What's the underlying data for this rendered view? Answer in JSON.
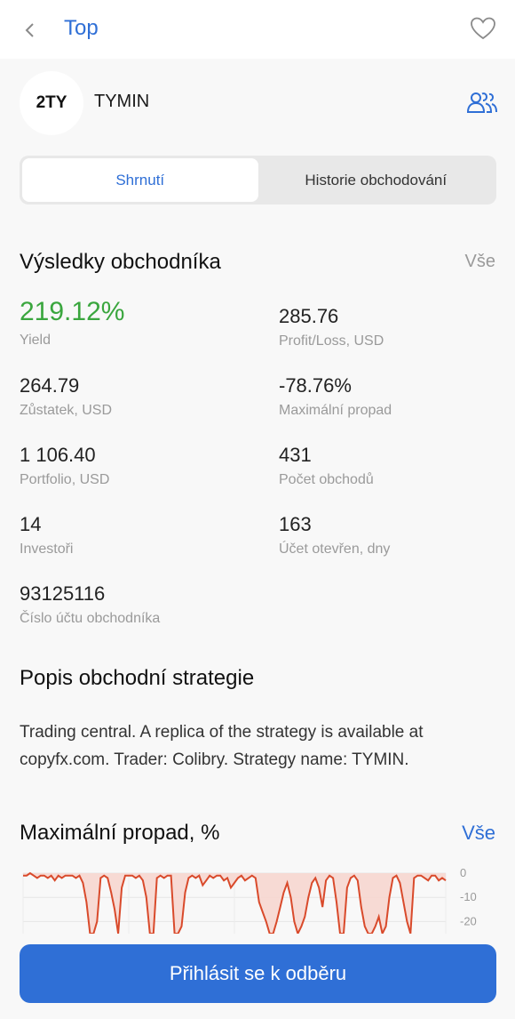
{
  "header": {
    "back_icon": "chevron-left-icon",
    "title": "Top",
    "favorite_icon": "heart-outline-icon"
  },
  "trader": {
    "avatar_text": "2TY",
    "name": "TYMIN",
    "investors_icon": "people-icon"
  },
  "tabs": [
    {
      "label": "Shrnutí",
      "active": true
    },
    {
      "label": "Historie obchodování",
      "active": false
    }
  ],
  "results": {
    "title": "Výsledky obchodníka",
    "all_link": "Vše",
    "stats": [
      {
        "value": "219.12%",
        "label": "Yield"
      },
      {
        "value": "285.76",
        "label": "Profit/Loss, USD"
      },
      {
        "value": "264.79",
        "label": "Zůstatek, USD"
      },
      {
        "value": "-78.76%",
        "label": "Maximální propad"
      },
      {
        "value": "1 106.40",
        "label": "Portfolio, USD"
      },
      {
        "value": "431",
        "label": "Počet obchodů"
      },
      {
        "value": "14",
        "label": "Investoři"
      },
      {
        "value": "163",
        "label": "Účet otevřen, dny"
      },
      {
        "value": "93125116",
        "label": "Číslo účtu obchodníka"
      }
    ]
  },
  "strategy": {
    "title": "Popis obchodní strategie",
    "text": "Trading central. A replica of the strategy is available at copyfx.com. Trader: Colibry. Strategy name: TYMIN."
  },
  "drawdown": {
    "title": "Maximální propad, %",
    "all_link": "Vše"
  },
  "chart_data": {
    "type": "area",
    "title": "Maximální propad, %",
    "ytick_labels": [
      "0",
      "-10",
      "-20"
    ],
    "ylim": [
      -25,
      0
    ],
    "values": [
      -1,
      -1,
      0,
      -1,
      -2,
      -1,
      -1,
      -2,
      -1,
      -3,
      -1,
      -2,
      -1,
      -1,
      -1,
      -2,
      -1,
      -4,
      -12,
      -25,
      -25,
      -20,
      -2,
      -1,
      -2,
      -8,
      -15,
      -25,
      -6,
      -1,
      -1,
      -1,
      -2,
      -1,
      -3,
      -10,
      -25,
      -25,
      -2,
      -1,
      -2,
      -1,
      -1,
      -25,
      -25,
      -22,
      -8,
      -2,
      -1,
      -2,
      -1,
      -5,
      -3,
      -1,
      -2,
      -1,
      -1,
      -3,
      -2,
      -6,
      -4,
      -2,
      -1,
      -3,
      -2,
      -1,
      -2,
      -12,
      -16,
      -20,
      -25,
      -25,
      -20,
      -14,
      -8,
      -4,
      -10,
      -20,
      -25,
      -22,
      -18,
      -10,
      -4,
      -2,
      -6,
      -14,
      -3,
      -1,
      -2,
      -12,
      -25,
      -25,
      -6,
      -2,
      -1,
      -3,
      -14,
      -22,
      -25,
      -25,
      -22,
      -18,
      -25,
      -22,
      -10,
      -2,
      -1,
      -4,
      -12,
      -20,
      -25,
      -2,
      -1,
      -1,
      -2,
      -3,
      -1,
      -1,
      -3,
      -2,
      -3
    ],
    "series_color": "#d94a2b",
    "fill_color": "#f6d6cf",
    "grid": true
  },
  "cta": {
    "label": "Přihlásit se k odběru"
  },
  "colors": {
    "accent": "#2f6fd6",
    "positive": "#3aa63e"
  }
}
